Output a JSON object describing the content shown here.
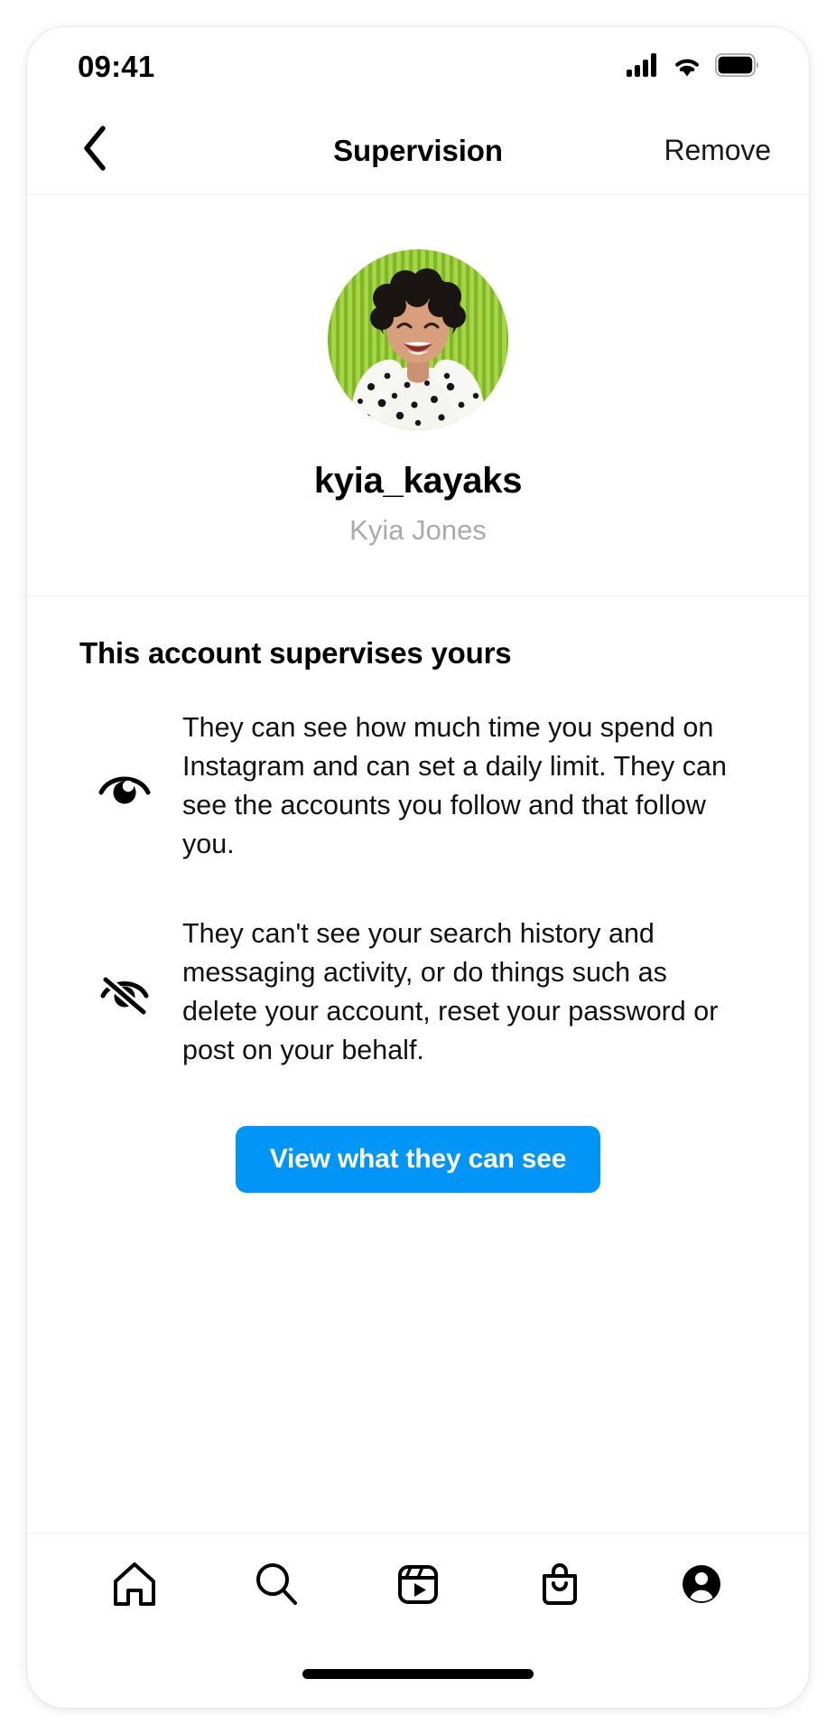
{
  "status_bar": {
    "time": "09:41",
    "signal_icon": "cellular-signal-icon",
    "wifi_icon": "wifi-icon",
    "battery_icon": "battery-full-icon",
    "signal_bars": 4,
    "battery_level_pct": 100
  },
  "navbar": {
    "back_icon": "chevron-left-icon",
    "title": "Supervision",
    "action_label": "Remove"
  },
  "profile": {
    "avatar_alt": "kyia_kayaks profile photo",
    "username": "kyia_kayaks",
    "full_name": "Kyia Jones"
  },
  "info_section": {
    "title": "This account supervises yours",
    "rows": [
      {
        "icon": "eye-icon",
        "text": "They can see how much time you spend on Instagram and can set a daily limit. They can see the accounts you follow and that follow you."
      },
      {
        "icon": "eye-off-icon",
        "text": "They can't see your search history and messaging activity, or do things such as delete your account, reset your password or post on your behalf."
      }
    ],
    "cta_label": "View what they can see"
  },
  "tabbar": {
    "items": [
      {
        "icon": "home-icon",
        "name": "tab-home"
      },
      {
        "icon": "search-icon",
        "name": "tab-search"
      },
      {
        "icon": "reels-icon",
        "name": "tab-reels"
      },
      {
        "icon": "shop-icon",
        "name": "tab-shop"
      },
      {
        "icon": "profile-icon",
        "name": "tab-profile"
      }
    ],
    "active_index": 4
  },
  "colors": {
    "accent_blue": "#0095f6",
    "text_primary": "#000000",
    "text_secondary": "#aaaaaa",
    "divider": "#efefef",
    "avatar_background_green": "#9ccf3c"
  }
}
